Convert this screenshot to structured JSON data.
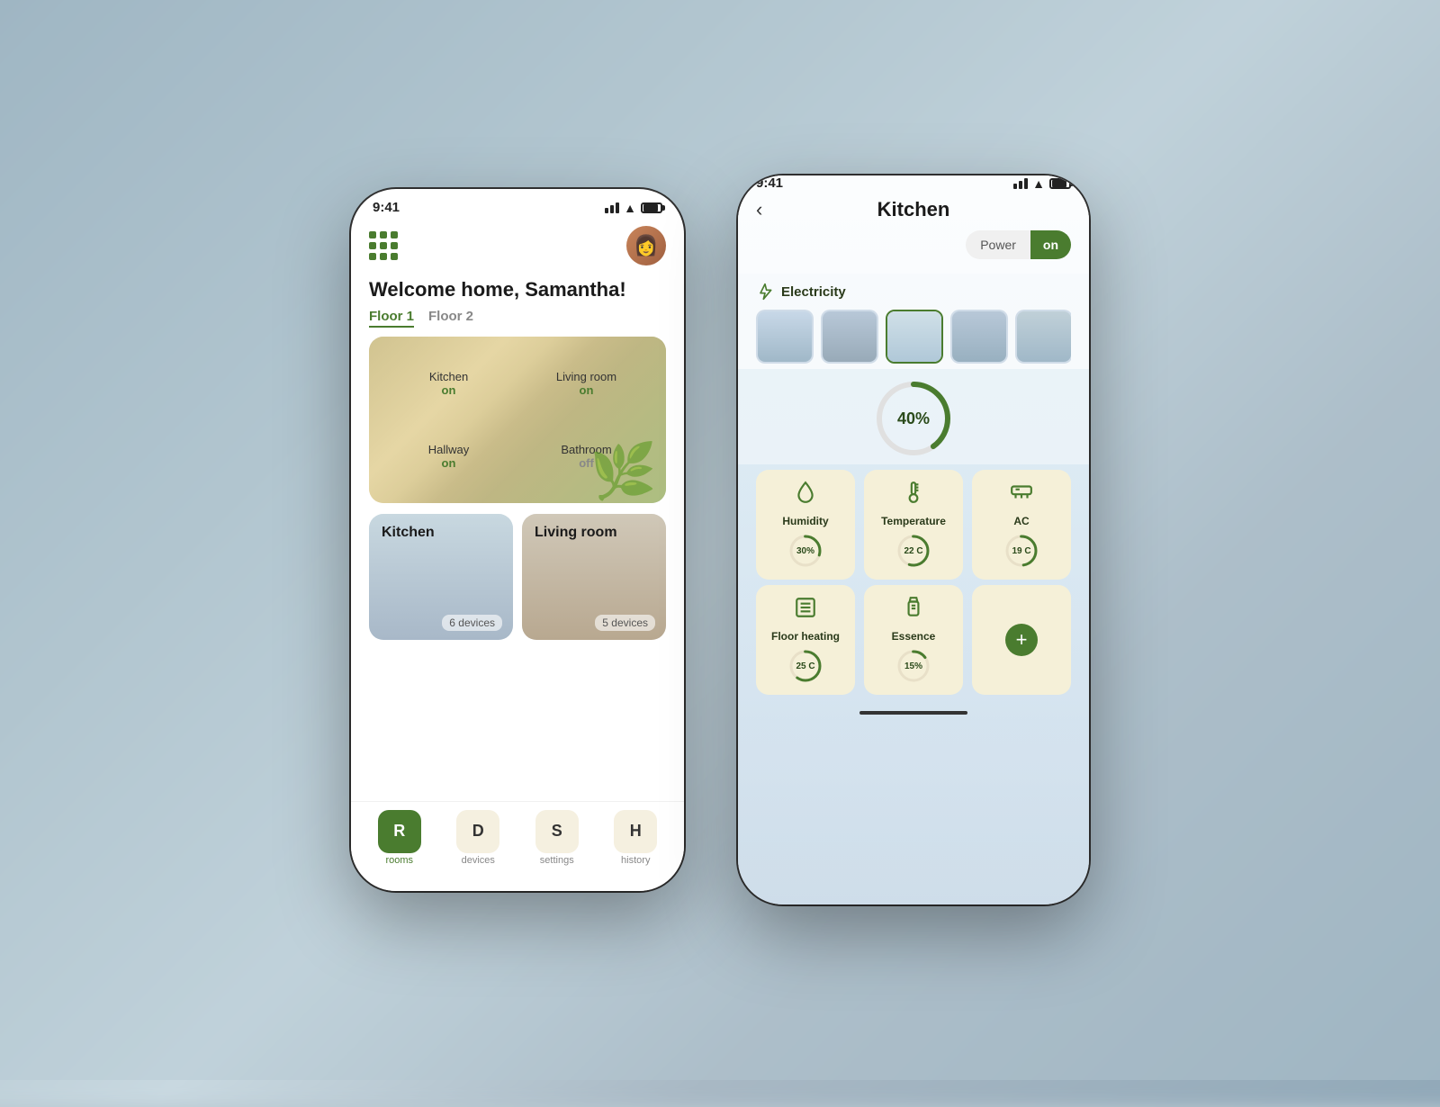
{
  "background": {
    "color": "#b8c8d0"
  },
  "phone_left": {
    "status_bar": {
      "time": "9:41"
    },
    "welcome_text": "Welcome home, Samantha!",
    "floor_tabs": [
      {
        "label": "Floor 1",
        "active": true
      },
      {
        "label": "Floor 2",
        "active": false
      }
    ],
    "room_overview": {
      "rooms": [
        {
          "name": "Kitchen",
          "status": "on"
        },
        {
          "name": "Living room",
          "status": "on"
        },
        {
          "name": "Hallway",
          "status": "on"
        },
        {
          "name": "Bathroom",
          "status": "off"
        }
      ]
    },
    "room_cards": [
      {
        "name": "Kitchen",
        "devices": "6 devices"
      },
      {
        "name": "Living room",
        "devices": "5 devices"
      }
    ],
    "bottom_nav": [
      {
        "icon": "R",
        "label": "rooms",
        "active": true
      },
      {
        "icon": "D",
        "label": "devices",
        "active": false
      },
      {
        "icon": "S",
        "label": "settings",
        "active": false
      },
      {
        "icon": "H",
        "label": "history",
        "active": false
      }
    ]
  },
  "phone_right": {
    "status_bar": {
      "time": "9:41"
    },
    "title": "Kitchen",
    "power": {
      "label": "Power",
      "state": "on"
    },
    "electricity": {
      "label": "Electricity",
      "gauge_value": "40%",
      "light_count": 5
    },
    "devices_row1": [
      {
        "name": "Humidity",
        "icon": "💧",
        "value": "30%"
      },
      {
        "name": "Temperature",
        "icon": "🌡",
        "value": "22 C"
      },
      {
        "name": "AC",
        "icon": "❄",
        "value": "19 C"
      }
    ],
    "devices_row2": [
      {
        "name": "Floor heating",
        "icon": "🔲",
        "value": "25 C"
      },
      {
        "name": "Essence",
        "icon": "🧴",
        "value": "15%"
      },
      {
        "name": "add",
        "icon": "+",
        "value": ""
      }
    ]
  }
}
